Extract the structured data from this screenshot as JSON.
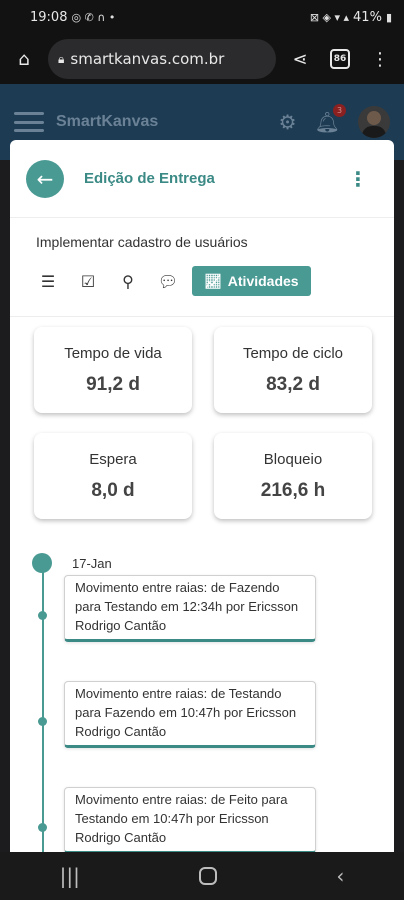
{
  "statusbar": {
    "time": "19:08",
    "battery": "41%"
  },
  "browser": {
    "url": "smartkanvas.com.br",
    "tab_count": "86"
  },
  "app": {
    "brand": "SmartKanvas",
    "notification_count": "3"
  },
  "modal": {
    "title": "Edição de Entrega",
    "task_title": "Implementar cadastro de usuários",
    "active_tab": "Atividades"
  },
  "metrics": [
    {
      "label": "Tempo de vida",
      "value": "91,2 d"
    },
    {
      "label": "Tempo de ciclo",
      "value": "83,2 d"
    },
    {
      "label": "Espera",
      "value": "8,0 d"
    },
    {
      "label": "Bloqueio",
      "value": "216,6 h"
    }
  ],
  "timeline": {
    "date": "17-Jan",
    "items": [
      {
        "text": "Movimento entre raias: de Fazendo para Testando em 12:34h por Ericsson Rodrigo Cantão"
      },
      {
        "text": "Movimento entre raias: de Testando para Fazendo em 10:47h por Ericsson Rodrigo Cantão"
      },
      {
        "text": "Movimento entre raias: de Feito para Testando em 10:47h por Ericsson Rodrigo Cantão"
      }
    ]
  },
  "colors": {
    "accent": "#4a9a94",
    "header": "#1d3b53"
  }
}
